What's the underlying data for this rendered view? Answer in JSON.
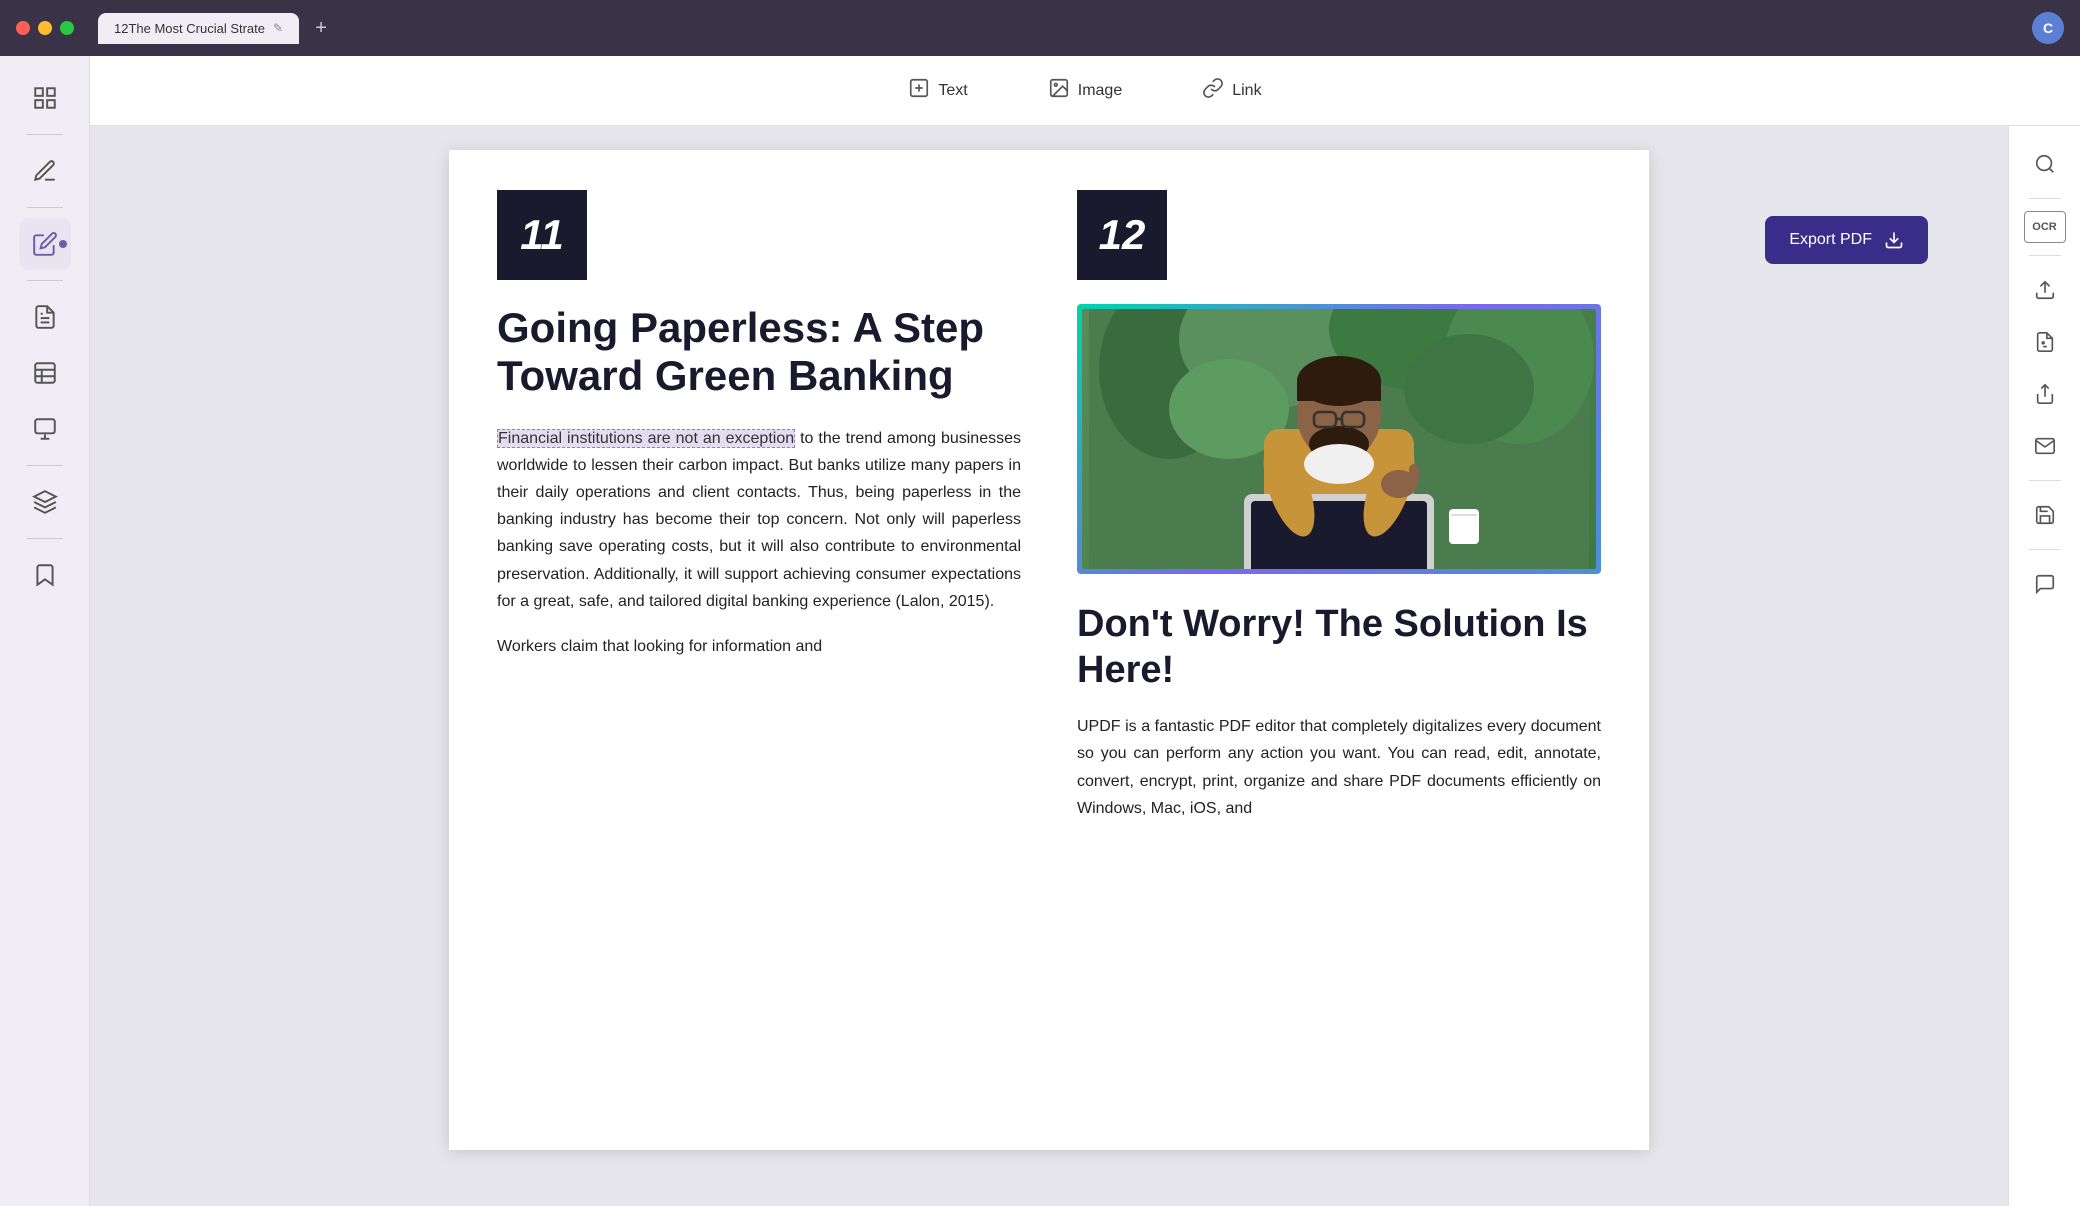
{
  "titlebar": {
    "tab_title": "12The Most Crucial Strate",
    "add_tab_label": "+"
  },
  "user": {
    "avatar_initial": "C"
  },
  "toolbar": {
    "text_label": "Text",
    "image_label": "Image",
    "link_label": "Link"
  },
  "sidebar": {
    "items": [
      {
        "id": "pages",
        "icon": "☰",
        "active": false
      },
      {
        "id": "annotate",
        "icon": "✏️",
        "active": false
      },
      {
        "id": "edit",
        "icon": "📝",
        "active": true
      },
      {
        "id": "organize",
        "icon": "📄",
        "active": false
      },
      {
        "id": "layout",
        "icon": "⬛",
        "active": false
      },
      {
        "id": "stamps",
        "icon": "🖼️",
        "active": false
      },
      {
        "id": "layers",
        "icon": "⧉",
        "active": false
      },
      {
        "id": "bookmark",
        "icon": "🔖",
        "active": false
      }
    ]
  },
  "right_panel": {
    "items": [
      {
        "id": "search",
        "icon": "🔍"
      },
      {
        "id": "ocr",
        "icon": "OCR"
      },
      {
        "id": "export",
        "icon": "📤"
      },
      {
        "id": "document-info",
        "icon": "📋"
      },
      {
        "id": "share",
        "icon": "↑"
      },
      {
        "id": "email",
        "icon": "✉️"
      },
      {
        "id": "save",
        "icon": "💾"
      },
      {
        "id": "chat",
        "icon": "💬"
      }
    ]
  },
  "document": {
    "left_column": {
      "number": "11",
      "title": "Going Paperless: A Step Toward Green Banking",
      "highlighted_text": "Financial institutions are not an exception",
      "body_text": " to the trend among businesses worldwide to lessen their carbon impact. But banks utilize many papers in their daily operations and client contacts. Thus, being paperless in the banking industry has become their top concern. Not only will paperless banking save operating costs, but it will also contribute to environmental preservation. Additionally, it will support achieving consumer expectations for a great, safe, and tailored digital banking experience (Lalon, 2015).",
      "body_text_2": "Workers claim that looking for information and"
    },
    "right_column": {
      "number": "12",
      "section_title": "Don't Worry! The Solution Is Here!",
      "body_text": "UPDF is a fantastic PDF editor that completely digitalizes every document so you can perform any action you want. You can read, edit, annotate, convert, encrypt, print, organize and share PDF documents efficiently on Windows, Mac, iOS, and"
    }
  },
  "export_button": {
    "label": "Export PDF"
  }
}
